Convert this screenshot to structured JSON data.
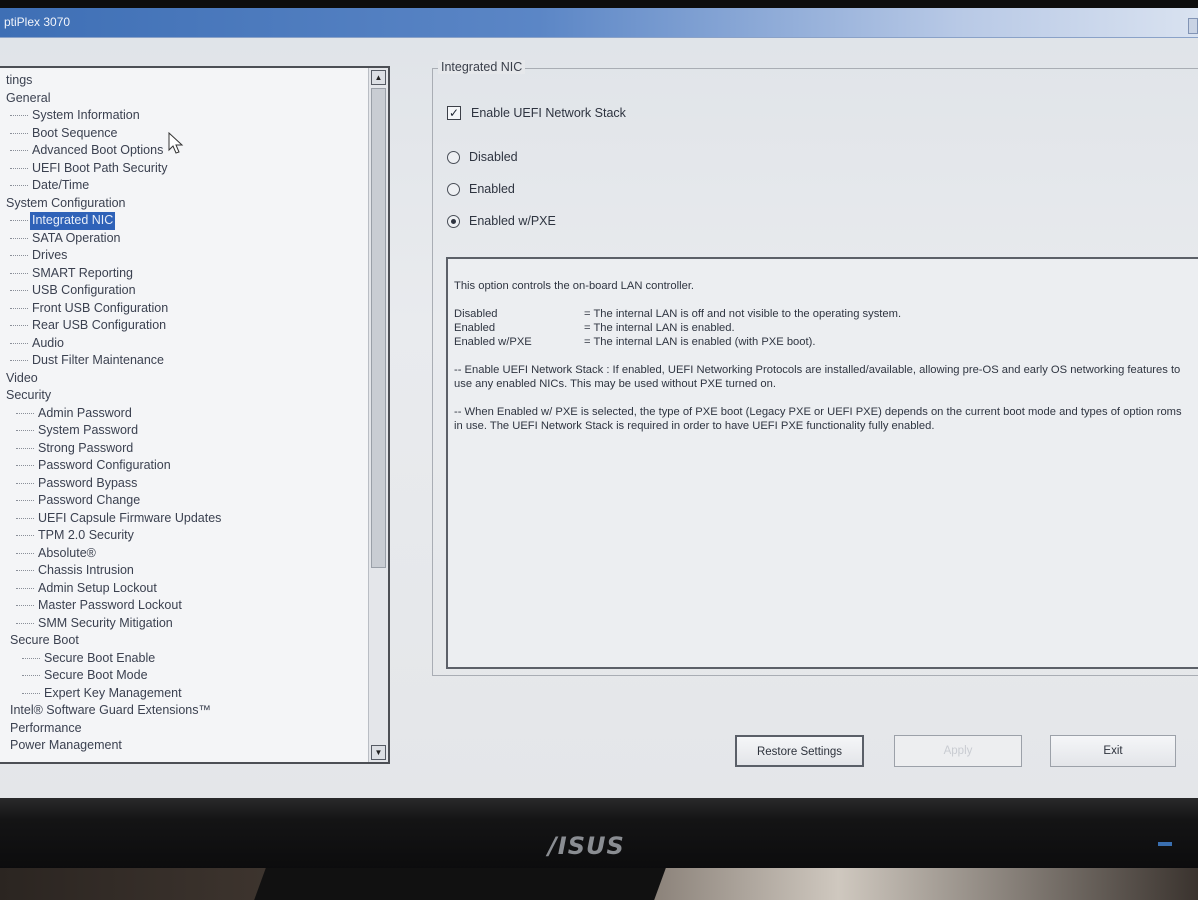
{
  "window": {
    "title": "ptiPlex 3070"
  },
  "tree": {
    "items": [
      {
        "label": "tings",
        "level": 0
      },
      {
        "label": "General",
        "level": 0
      },
      {
        "label": "System Information",
        "level": 2
      },
      {
        "label": "Boot Sequence",
        "level": 2
      },
      {
        "label": "Advanced Boot Options",
        "level": 2
      },
      {
        "label": "UEFI Boot Path Security",
        "level": 2
      },
      {
        "label": "Date/Time",
        "level": 2
      },
      {
        "label": "System Configuration",
        "level": 0
      },
      {
        "label": "Integrated NIC",
        "level": 2,
        "selected": true
      },
      {
        "label": "SATA Operation",
        "level": 2
      },
      {
        "label": "Drives",
        "level": 2
      },
      {
        "label": "SMART Reporting",
        "level": 2
      },
      {
        "label": "USB Configuration",
        "level": 2
      },
      {
        "label": "Front USB Configuration",
        "level": 2
      },
      {
        "label": "Rear USB Configuration",
        "level": 2
      },
      {
        "label": "Audio",
        "level": 2
      },
      {
        "label": "Dust Filter Maintenance",
        "level": 2
      },
      {
        "label": "Video",
        "level": 0
      },
      {
        "label": "Security",
        "level": 0
      },
      {
        "label": "Admin Password",
        "level": 3
      },
      {
        "label": "System Password",
        "level": 3
      },
      {
        "label": "Strong Password",
        "level": 3
      },
      {
        "label": "Password Configuration",
        "level": 3
      },
      {
        "label": "Password Bypass",
        "level": 3
      },
      {
        "label": "Password Change",
        "level": 3
      },
      {
        "label": "UEFI Capsule Firmware Updates",
        "level": 3
      },
      {
        "label": "TPM 2.0 Security",
        "level": 3
      },
      {
        "label": "Absolute®",
        "level": 3
      },
      {
        "label": "Chassis Intrusion",
        "level": 3
      },
      {
        "label": "Admin Setup Lockout",
        "level": 3
      },
      {
        "label": "Master Password Lockout",
        "level": 3
      },
      {
        "label": "SMM Security Mitigation",
        "level": 3
      },
      {
        "label": "Secure Boot",
        "level": 1
      },
      {
        "label": "Secure Boot Enable",
        "level": 4
      },
      {
        "label": "Secure Boot Mode",
        "level": 4
      },
      {
        "label": "Expert Key Management",
        "level": 4
      },
      {
        "label": "Intel® Software Guard Extensions™",
        "level": 1
      },
      {
        "label": "Performance",
        "level": 1
      },
      {
        "label": "Power Management",
        "level": 1
      }
    ]
  },
  "nic": {
    "group_title": "Integrated NIC",
    "uefi_stack": {
      "label": "Enable UEFI Network Stack",
      "checked": true
    },
    "options": [
      {
        "label": "Disabled",
        "selected": false
      },
      {
        "label": "Enabled",
        "selected": false
      },
      {
        "label": "Enabled w/PXE",
        "selected": true
      }
    ]
  },
  "help": {
    "intro": "This option controls the on-board LAN controller.",
    "definitions": [
      {
        "term": "Disabled",
        "desc": "= The internal LAN is off and not visible to the operating system."
      },
      {
        "term": "Enabled",
        "desc": "= The internal LAN is enabled."
      },
      {
        "term": "Enabled w/PXE",
        "desc": "= The internal LAN is enabled (with PXE boot)."
      }
    ],
    "para1": "-- Enable UEFI Network Stack : If enabled, UEFI Networking Protocols are installed/available, allowing pre-OS and early OS networking features to use any enabled NICs. This may be used without PXE turned on.",
    "para2": "-- When Enabled w/ PXE is selected, the type of PXE boot (Legacy PXE or UEFI PXE) depends on the current boot mode and types of option roms in use. The UEFI Network Stack is required in order to have UEFI PXE functionality fully enabled."
  },
  "buttons": {
    "restore": "Restore Settings",
    "apply": "Apply",
    "exit": "Exit"
  },
  "monitor": {
    "brand": "/ISUS"
  }
}
